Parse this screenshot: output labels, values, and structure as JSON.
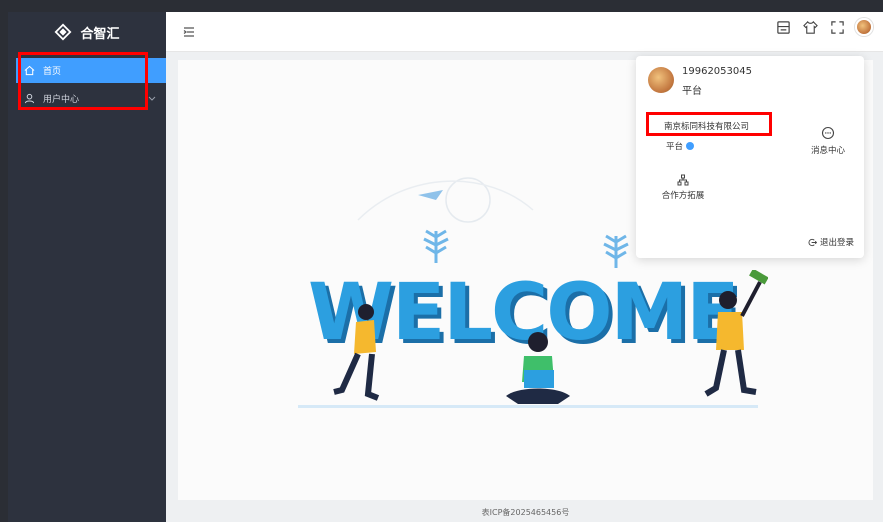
{
  "app": {
    "name": "合智汇"
  },
  "sidebar": {
    "items": [
      {
        "label": "首页",
        "icon": "home-icon",
        "active": true
      },
      {
        "label": "用户中心",
        "icon": "user-icon",
        "active": false
      }
    ]
  },
  "header": {
    "icons": [
      "menu-fold-icon",
      "document-icon",
      "skin-icon",
      "fullscreen-icon",
      "avatar"
    ]
  },
  "main": {
    "welcome_text": "WELCOME",
    "footer": "表ICP备2025465456号"
  },
  "user_menu": {
    "phone": "19962053045",
    "platform": "平台",
    "company": "南京标同科技有限公司",
    "platform_tag": "平台",
    "message_center": "消息中心",
    "cooperation": "合作方拓展",
    "logout": "退出登录"
  },
  "colors": {
    "accent": "#409eff",
    "sidebar": "#2d323e",
    "highlight": "#ff0000",
    "welcome": "#2c9fe0"
  }
}
